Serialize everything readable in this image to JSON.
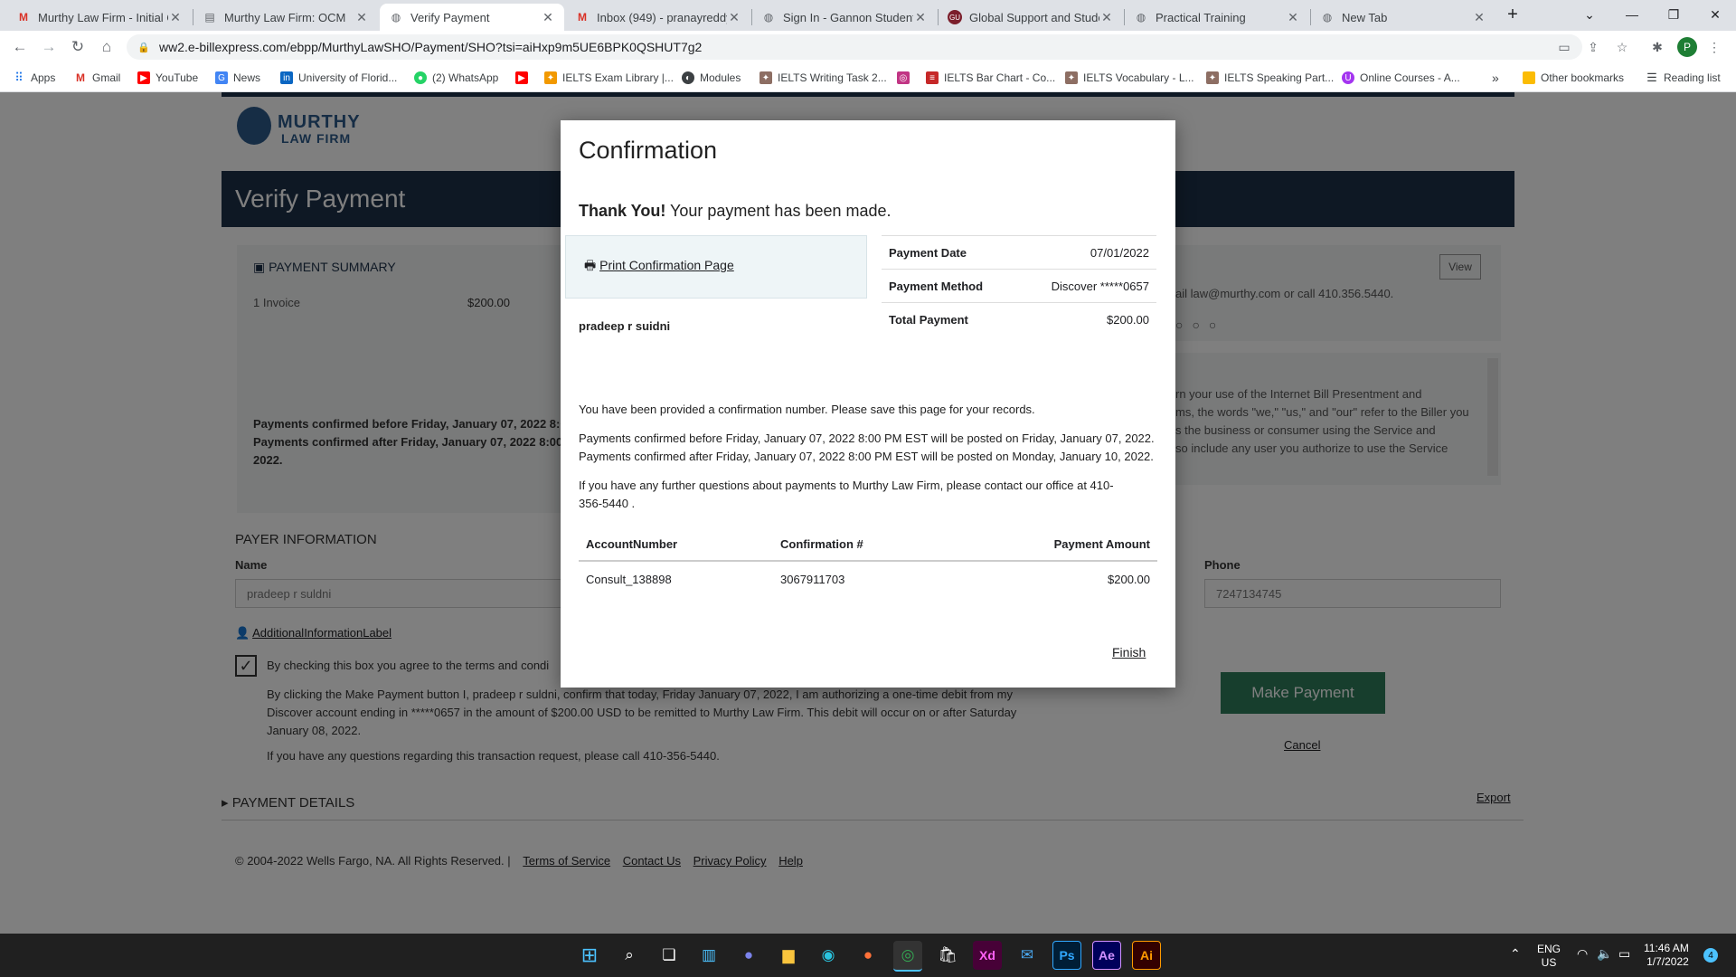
{
  "browser": {
    "tabs": [
      {
        "title": "Murthy Law Firm - Initial C",
        "favicon": "gmail-icon"
      },
      {
        "title": "Murthy Law Firm: OCM",
        "favicon": "doc-icon"
      },
      {
        "title": "Verify Payment",
        "favicon": "globe-icon",
        "active": true
      },
      {
        "title": "Inbox (949) - pranayreddy",
        "favicon": "gmail-icon"
      },
      {
        "title": "Sign In - Gannon Student",
        "favicon": "globe-icon"
      },
      {
        "title": "Global Support and Stude",
        "favicon": "gu-icon"
      },
      {
        "title": "Practical Training",
        "favicon": "globe-icon"
      },
      {
        "title": "New Tab",
        "favicon": "globe-icon"
      }
    ],
    "url": "ww2.e-billexpress.com/ebpp/MurthyLawSHO/Payment/SHO?tsi=aiHxp9m5UE6BPK0QSHUT7g2",
    "profile_initial": "P",
    "bookmarks": [
      {
        "label": "Apps",
        "icon": "apps-grid-icon"
      },
      {
        "label": "Gmail",
        "icon": "gmail-icon"
      },
      {
        "label": "YouTube",
        "icon": "youtube-icon"
      },
      {
        "label": "News",
        "icon": "news-icon"
      },
      {
        "label": "University of Florid...",
        "icon": "linkedin-icon"
      },
      {
        "label": "(2) WhatsApp",
        "icon": "whatsapp-icon"
      },
      {
        "label": "",
        "icon": "youtube-icon"
      },
      {
        "label": "IELTS Exam Library |...",
        "icon": "ielts-icon"
      },
      {
        "label": "Modules",
        "icon": "modules-icon"
      },
      {
        "label": "IELTS Writing Task 2...",
        "icon": "ielts-icon"
      },
      {
        "label": "",
        "icon": "instagram-icon"
      },
      {
        "label": "IELTS Bar Chart - Co...",
        "icon": "ielts-icon"
      },
      {
        "label": "IELTS Vocabulary - L...",
        "icon": "ielts-icon"
      },
      {
        "label": "IELTS Speaking Part...",
        "icon": "ielts-icon"
      },
      {
        "label": "Online Courses - A...",
        "icon": "udemy-icon"
      }
    ],
    "other_bookmarks": "Other bookmarks",
    "reading_list": "Reading list",
    "more_chevron": "»"
  },
  "background_page": {
    "logo_line1": "MURTHY",
    "logo_line2": "LAW FIRM",
    "header_title": "Verify Payment",
    "summary_title": "PAYMENT SUMMARY",
    "summary_invoice_label": "1 Invoice",
    "summary_invoice_amount": "$200.00",
    "summary_note_line1": "Payments confirmed before Friday, January 07, 2022 8:00",
    "summary_note_line2": "Payments confirmed after Friday, January 07, 2022 8:00 P",
    "summary_note_line3": "2022.",
    "view_button": "View",
    "contact_text": "ail law@murthy.com or call 410.356.5440.",
    "terms_lines": [
      "rn your use of the Internet Bill Presentment and",
      "ms, the words \"we,\" \"us,\" and \"our\" refer to the Biller you",
      "s the business or consumer using the Service and",
      "so include any user you authorize to use the Service"
    ],
    "payer_title": "PAYER INFORMATION",
    "name_label": "Name",
    "name_value": "pradeep r suldni",
    "phone_label": "Phone",
    "phone_value": "7247134745",
    "additional_info_link": "AdditionalInformationLabel",
    "agree_text": "By checking this box you agree to the terms and condi",
    "auth_line1": "By clicking the Make Payment button I, pradeep r suldni, confirm that today, Friday January 07, 2022, I am authorizing a one-time debit from my",
    "auth_line2": "Discover account ending in *****0657 in the amount of $200.00 USD to be remitted to Murthy Law Firm. This debit will occur on or after Saturday",
    "auth_line3": "January 08, 2022.",
    "questions_text": "If you have any questions regarding this transaction request, please call 410-356-5440.",
    "make_payment_button": "Make Payment",
    "cancel_link": "Cancel",
    "payment_details_title": "PAYMENT DETAILS",
    "export_link": "Export",
    "footer_copyright": "© 2004-2022 Wells Fargo, NA. All Rights Reserved. |",
    "footer_links": [
      "Terms of Service",
      "Contact Us",
      "Privacy Policy",
      "Help"
    ]
  },
  "modal": {
    "title": "Confirmation",
    "thank_you_bold": "Thank You!",
    "thank_you_rest": " Your payment has been made.",
    "print_link": "Print Confirmation Page",
    "payer_name": "pradeep r suidni",
    "summary": [
      {
        "label": "Payment Date",
        "value": "07/01/2022"
      },
      {
        "label": "Payment Method",
        "value": "Discover *****0657"
      },
      {
        "label": "Total Payment",
        "value": "$200.00"
      }
    ],
    "confirmation_note": "You have been provided a confirmation number. Please save this page for your records.",
    "posting_before": "Payments confirmed before Friday, January 07, 2022 8:00 PM EST will be posted on Friday, January 07, 2022.",
    "posting_after": "Payments confirmed after Friday, January 07, 2022 8:00 PM EST will be posted on Monday, January 10, 2022.",
    "questions_line1": "If you have any further questions about payments to Murthy Law Firm, please contact our office at 410-",
    "questions_line2": "356-5440 .",
    "table": {
      "headers": [
        "AccountNumber",
        "Confirmation #",
        "Payment Amount"
      ],
      "rows": [
        [
          "Consult_138898",
          "3067911703",
          "$200.00"
        ]
      ]
    },
    "finish_link": "Finish"
  },
  "taskbar": {
    "apps": [
      "windows-start-icon",
      "search-icon",
      "task-view-icon",
      "widgets-icon",
      "teams-chat-icon",
      "file-explorer-icon",
      "edge-icon",
      "firefox-icon",
      "chrome-icon",
      "store-icon",
      "adobe-xd-icon",
      "mail-icon",
      "photoshop-icon",
      "after-effects-icon",
      "illustrator-icon"
    ],
    "xd_label": "Xd",
    "ps_label": "Ps",
    "ae_label": "Ae",
    "ai_label": "Ai",
    "language_line1": "ENG",
    "language_line2": "US",
    "time": "11:46 AM",
    "date": "1/7/2022",
    "notification_count": "4"
  },
  "colors": {
    "header_navy": "#1d3048",
    "button_green": "#2e7d5b",
    "overlay": "rgba(0,0,0,0.5)"
  }
}
